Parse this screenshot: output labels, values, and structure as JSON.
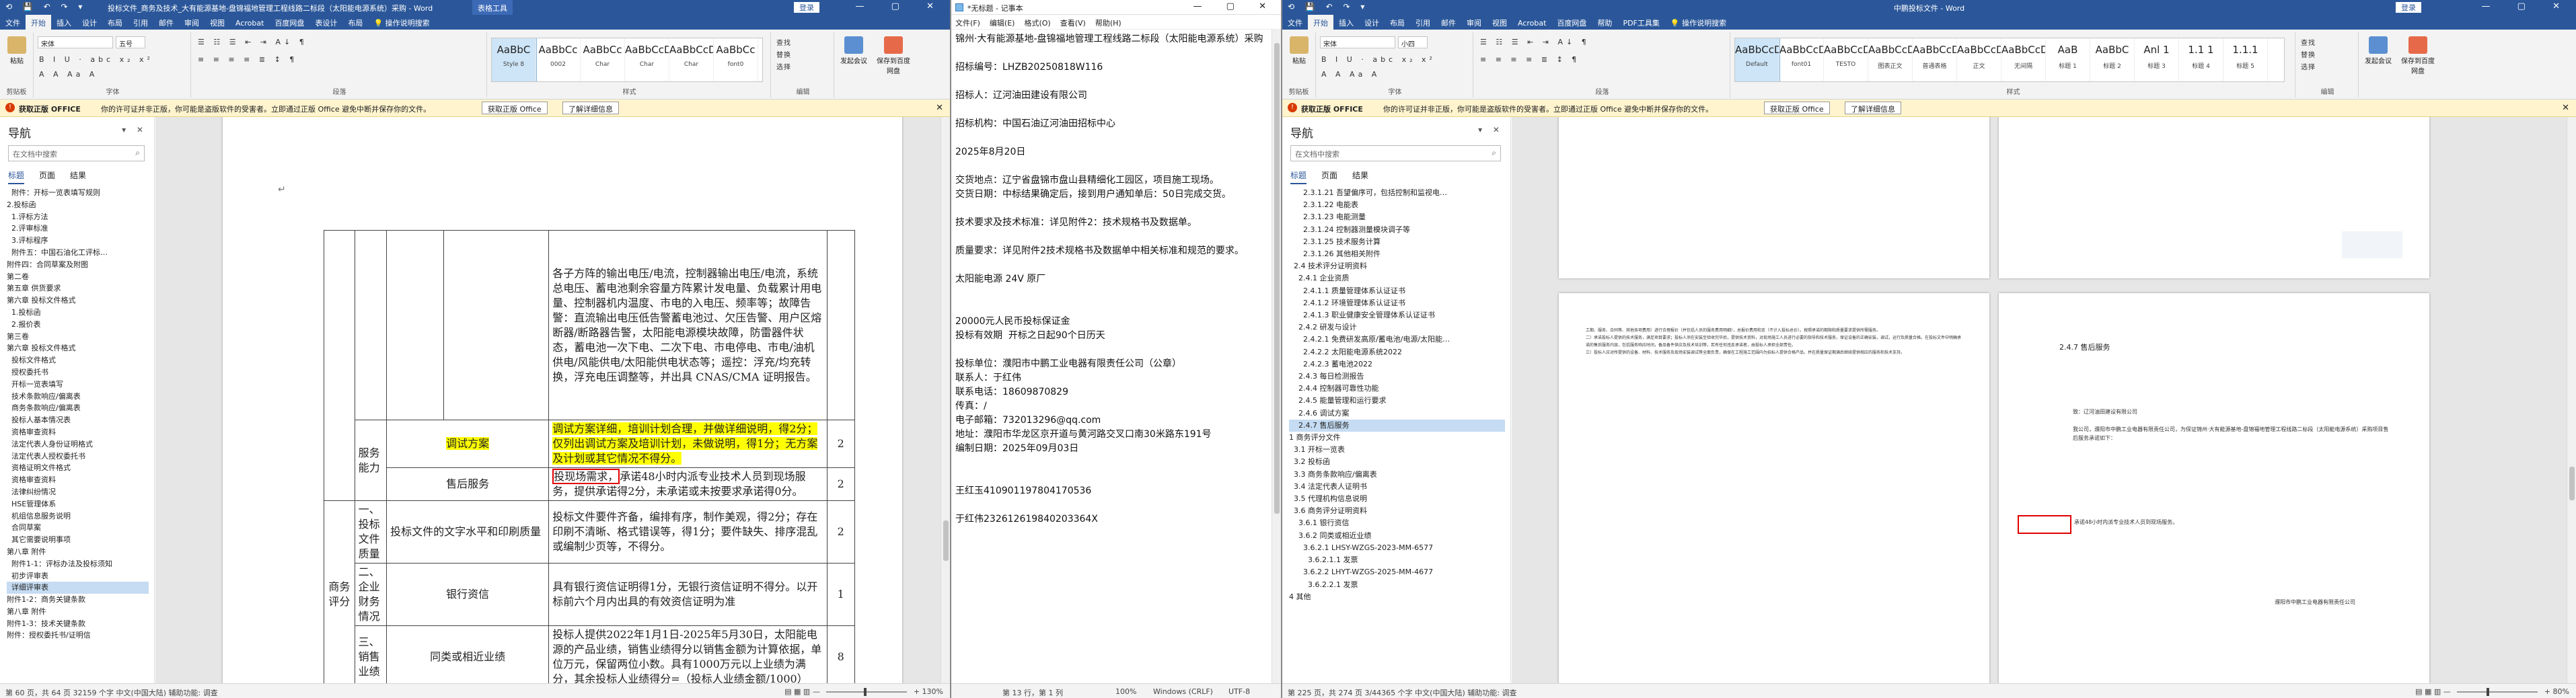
{
  "w1": {
    "title": "投标文件_商务及技术_大有能源基地-盘锦福地管理工程线路二标段（太阳能电源系统）采购 - Word",
    "tool_title": "表格工具",
    "account_btn": "登录",
    "tabs": [
      "文件",
      "开始",
      "插入",
      "设计",
      "布局",
      "引用",
      "邮件",
      "审阅",
      "视图",
      "Acrobat",
      "百度网盘",
      "表设计",
      "布局"
    ],
    "tell_me": "操作说明搜索",
    "clipboard": {
      "paste": "粘贴",
      "label": "剪贴板"
    },
    "font": {
      "name": "宋体",
      "size": "五号",
      "label": "字体",
      "buttons": "B I U · abc x₂ x²"
    },
    "paragraph": {
      "label": "段落",
      "buttons": "≡ ≡ ≡ ≡ ≣ ↕ ¶"
    },
    "styles": {
      "items": [
        {
          "preview": "AaBbC",
          "name": "Style 8"
        },
        {
          "preview": "AaBbCc",
          "name": "0002"
        },
        {
          "preview": "AaBbCc",
          "name": "Char"
        },
        {
          "preview": "AaBbCcDt",
          "name": "Char"
        },
        {
          "preview": "AaBbCcDt",
          "name": "Char"
        },
        {
          "preview": "AaBbCc",
          "name": "font0"
        }
      ],
      "label": "样式"
    },
    "editing": {
      "find": "查找",
      "replace": "替换",
      "select": "选择",
      "label": "编辑"
    },
    "extras": [
      "发起会议",
      "保存到百度网盘"
    ],
    "message": {
      "bold": "获取正版 OFFICE",
      "text": "你的许可证并非正版，你可能是盗版软件的受害者。立即通过正版 Office 避免中断并保存你的文件。",
      "btn1": "获取正版 Office",
      "btn2": "了解详细信息"
    },
    "nav": {
      "title": "导航",
      "search": "在文档中搜索",
      "tabs": [
        "标题",
        "页面",
        "结果"
      ],
      "items": [
        "  附件：开标一览表填写规则",
        "2.投标函",
        "  1.评标方法",
        "  2.评审标准",
        "  3.评标程序",
        "  附件五：中国石油化工评标…",
        "附件四：合同草案及附图",
        "第二卷",
        "第五章 供货要求",
        "第六章 投标文件格式",
        "  1.投标函",
        "  2.报价表",
        "第三卷",
        "第六章 投标文件格式",
        "  投标文件格式",
        "  授权委托书",
        "  开标一览表填写",
        "  技术条款响应/偏离表",
        "  商务条款响应/偏离表",
        "  投标人基本情况表",
        "  资格审查资料",
        "  法定代表人身份证明格式",
        "  法定代表人授权委托书",
        "  资格证明文件格式",
        "  资格审查资料",
        "  法律纠纷情况",
        "  HSE管理体系",
        "  机组信息服务说明",
        "  合同草案",
        "  其它需要说明事项",
        "第八章 附件",
        "  附件1-1：评标办法及投标须知",
        "  初步评审表",
        "  详细评审表",
        "附件1-2：商务关键条款",
        "第八章 附件",
        "附件1-3：技术关键条款",
        "附件：授权委托书/证明信"
      ],
      "selected": 33
    },
    "table": {
      "r1c3": "各子方阵的输出电压/电流，控制器输出电压/电流，系统总电压、蓄电池剩余容量方阵累计发电量、负载累计用电量、控制器机内温度、市电的入电压、频率等；故障告警：直流输出电压低告警蓄电池过、欠压告警、用户区熔断器/断路器告警，太阳能电源模块故障，防雷器件状态，蓄电池一次下电、二次下电、市电停电、市电/油机供电/风能供电/太阳能供电状态等；遥控：浮充/均充转换，浮充电压调整等，并出具 CNAS/CMA 证明报告。",
      "r1c4": "",
      "service_label": "服务能力",
      "debug_label": "调试方案",
      "debug_text": "调试方案详细，培训计划合理，并做详细说明，得2分；仅列出调试方案及培训计划，未做说明，得1分；无方案及计划或其它情况不得分。",
      "debug_score": "2",
      "after_label": "售后服务",
      "after_text_hl": "投现场需求，",
      "after_text": "承诺48小时内派专业技术人员到现场服务，提供承诺得2分，未承诺或未按要求承诺得0分。",
      "after_score": "2",
      "business_label": "商务评分",
      "one_label": "一、投标文件质量",
      "quality_label": "投标文件的文字水平和印刷质量",
      "quality_text": "投标文件要件齐备，编排有序，制作美观，得2分；存在印刷不清晰、格式错误等，得1分；要件缺失、排序混乱或编制少页等，不得分。",
      "quality_score": "2",
      "two_label": "二、企业财务情况",
      "bank_label": "银行资信",
      "bank_text": "具有银行资信证明得1分，无银行资信证明不得分。以开标前六个月内出具的有效资信证明为准",
      "bank_score": "1",
      "three_label": "三、销售业绩",
      "same_label": "同类或相近业绩",
      "same_text": "投标人提供2022年1月1日-2025年5月30日，太阳能电源的产品业绩，销售业绩得分以销售金额为计算依据，单位万元，保留两位小数。具有1000万元以上业绩为满分，其余投标人业绩得分=（投标人业绩金额/1000）",
      "same_score": "8"
    },
    "status": {
      "left": "第 60 页，共 64 页    32159 个字    中文(中国大陆)    辅助功能: 调查",
      "right": "130%"
    }
  },
  "np": {
    "title": "*无标题 - 记事本",
    "menu": [
      "文件(F)",
      "编辑(E)",
      "格式(O)",
      "查看(V)",
      "帮助(H)"
    ],
    "lines": [
      "锦州·大有能源基地-盘锦福地管理工程线路二标段（太阳能电源系统）采购",
      "",
      "招标编号：LHZB20250818W116",
      "",
      "招标人：辽河油田建设有限公司",
      "",
      "招标机构：中国石油辽河油田招标中心",
      "",
      "2025年8月20日",
      "",
      "交货地点：辽宁省盘锦市盘山县精细化工园区，项目施工现场。",
      "交货日期：中标结果确定后，接到用户通知单后：50日完成交货。",
      "",
      "技术要求及技术标准：详见附件2：技术规格书及数据单。",
      "",
      "质量要求：详见附件2技术规格书及数据单中相关标准和规范的要求。",
      "",
      "太阳能电源 24V 原厂",
      "",
      "",
      "20000元人民币投标保证金",
      "投标有效期  开标之日起90个日历天",
      "",
      "投标单位：濮阳市中鹏工业电器有限责任公司（公章）",
      "联系人：于红伟",
      "联系电话：18609870829",
      "传真：/",
      "电子邮箱：732013296@qq.com",
      "地址：濮阳市华龙区京开道与黄河路交叉口南30米路东191号",
      "编制日期：2025年09月03日",
      "",
      "",
      "王红玉410901197804170536",
      "",
      "于红伟232612619840203364X"
    ],
    "status": [
      "第 13 行，第 1 列",
      "100%",
      "Windows (CRLF)",
      "UTF-8"
    ]
  },
  "w2": {
    "title": "中鹏投标文件 - Word",
    "account_btn": "登录",
    "tabs": [
      "文件",
      "开始",
      "插入",
      "设计",
      "布局",
      "引用",
      "邮件",
      "审阅",
      "视图",
      "Acrobat",
      "百度网盘",
      "帮助",
      "PDF工具集"
    ],
    "tell_me": "操作说明搜索",
    "font": {
      "name": "宋体",
      "size": "小四"
    },
    "styles": {
      "items": [
        {
          "preview": "AaBbCcDd",
          "name": "Default"
        },
        {
          "preview": "AaBbCcDd",
          "name": "font01"
        },
        {
          "preview": "AaBbCcDd",
          "name": "TESTO"
        },
        {
          "preview": "AaBbCcDd",
          "name": "图表正文"
        },
        {
          "preview": "AaBbCcDd",
          "name": "普通表格"
        },
        {
          "preview": "AaBbCcDd",
          "name": "正文"
        },
        {
          "preview": "AaBbCcDd",
          "name": "无间隔"
        },
        {
          "preview": "AaB",
          "name": "标题 1"
        },
        {
          "preview": "AaBbC",
          "name": "标题 2"
        },
        {
          "preview": "Anl 1",
          "name": "标题 3"
        },
        {
          "preview": "1.1 1",
          "name": "标题 4"
        },
        {
          "preview": "1.1.1",
          "name": "标题 5"
        }
      ]
    },
    "nav": {
      "title": "导航",
      "search": "在文档中搜索",
      "tabs": [
        "标题",
        "页面",
        "结果"
      ],
      "items": [
        "      2.3.1.21 吾望偏序可，包括控制和监视电…",
        "      2.3.1.22 电能表",
        "      2.3.1.23 电能测量",
        "      2.3.1.24 控制器测量模块调子等",
        "      2.3.1.25 技术服务计算",
        "      2.3.1.26 其他相关附件",
        "  2.4 技术评分证明资料",
        "    2.4.1 企业资质",
        "      2.4.1.1 质量管理体系认证证书",
        "      2.4.1.2 环境管理体系认证证书",
        "      2.4.1.3 职业健康安全管理体系认证证书",
        "    2.4.2 研发与设计",
        "      2.4.2.1 免费研发高原/蓄电池/电源/太阳能…",
        "      2.4.2.2 太阳能电源系统2022",
        "      2.4.2.3 蓄电池2022",
        "    2.4.3 每日检测报告",
        "    2.4.4 控制器可靠性功能",
        "    2.4.5 能量管理和运行要求",
        "    2.4.6 调试方案",
        "    2.4.7 售后服务",
        "1 商务评分文件",
        "  3.1 开标一览表",
        "  3.2 投标函",
        "  3.3 商务条款响应/偏离表",
        "  3.4 法定代表人证明书",
        "  3.5 代理机构信息说明",
        "  3.6 商务评分证明资料",
        "    3.6.1 银行资信",
        "    3.6.2 同类或相近业绩",
        "      3.6.2.1 LHSY-WZGS-2023-MM-6577",
        "        3.6.2.1.1 发票",
        "      3.6.2.2 LHYT-WZGS-2025-MM-4677",
        "        3.6.2.2.1 发票",
        "4 其他"
      ],
      "selected": 19
    },
    "page_right_heading": "2.4.7 售后服务",
    "page_right_body": "致：辽河油田建设有限公司\n\n我公司，濮阳市中鹏工业电器有限责任公司，为保证锦州·大有能源基地-盘锦福地管理工程线路二标段（太阳能电源系统）采购项目售后服务承诺如下：",
    "page_right_commit": "承诺48小时内派专业技术人员到现场服务。",
    "page_right_sign": "濮阳市中鹏工业电器有限责任公司",
    "page_left_text": "工期、服务、合同等、其他各项费用）进行合理报价（并包括人员的服务费用明细），总报价费用和支（不计入投标总价）。按照承诺的期限和质量要求提供所需服务。\n二）承诺投标人提供的技术服务，满足项目要求；投标人须在安装至验收完毕后，提供技术资料，对现场施工人员进行必要的指导和技术服务，保证设备的正确安装，调试，运行及质量合格。在投标文件中明确承诺的售后服务内容，包括服务响应时间，备品备件供应及技术培训等，若有任何违反承诺者，由投标人承担全部责任。\n三）投标人应对所提供的设备、材料、技术服务及现场安装调试等全面负责，确保在工程施工范围内为招标人提供合格产品，并在质量保证期满后继续提供相应的服务和技术支持。",
    "status": {
      "left": "第 225 页，共 274 页    3/44365 个字    中文(中国大陆)    辅助功能: 调查",
      "right": "80%"
    }
  }
}
